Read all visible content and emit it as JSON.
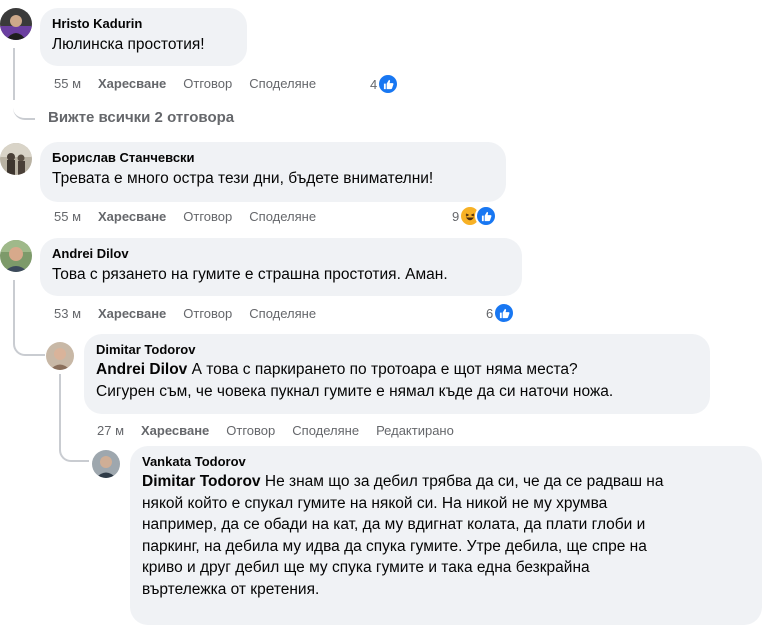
{
  "comments": [
    {
      "author": "Hristo Kadurin",
      "text": "Люлинска простотия!",
      "time": "55 м",
      "like": "Харесване",
      "reply": "Отговор",
      "share": "Споделяне",
      "reactions": "4"
    },
    {
      "author": "Борислав Станчевски",
      "text": "Тревата е много остра тези дни, бъдете внимателни!",
      "time": "55 м",
      "like": "Харесване",
      "reply": "Отговор",
      "share": "Споделяне",
      "reactions": "9"
    },
    {
      "author": "Andrei Dilov",
      "text": "Това с рязането на гумите е страшна простотия. Аман.",
      "time": "53 м",
      "like": "Харесване",
      "reply": "Отговор",
      "share": "Споделяне",
      "reactions": "6"
    }
  ],
  "view_replies": "Вижте всички 2 отговора",
  "replies": [
    {
      "author": "Dimitar Todorov",
      "mention": "Andrei Dilov",
      "line1": " А това с паркирането по тротоара е щот няма места?",
      "line2": "Сигурен съм, че човека пукнал гумите е нямал къде да си наточи ножа.",
      "time": "27 м",
      "like": "Харесване",
      "reply": "Отговор",
      "share": "Споделяне",
      "edited": "Редактирано"
    },
    {
      "author": "Vankata Todorov",
      "mention": "Dimitar Todorov",
      "line1": " Не знам що за дебил трябва да си, че да се радваш на",
      "line2": "някой който е спукал гумите на някой си. На никой не му хрумва",
      "line3": "например, да се обади на кат, да му вдигнат колата, да плати глоби и",
      "line4": "паркинг, на дебила му идва да спука гумите. Утре дебила, ще спре на",
      "line5": "криво и друг дебил ще му спука гумите и така една безкрайна",
      "line6": "въртележка от кретения."
    }
  ],
  "colors": {
    "bubble": "#f0f2f5",
    "meta": "#65676b",
    "like_blue": "#1877f2",
    "haha_yellow": "#f7b125",
    "thread_line": "#c9ccd1"
  }
}
